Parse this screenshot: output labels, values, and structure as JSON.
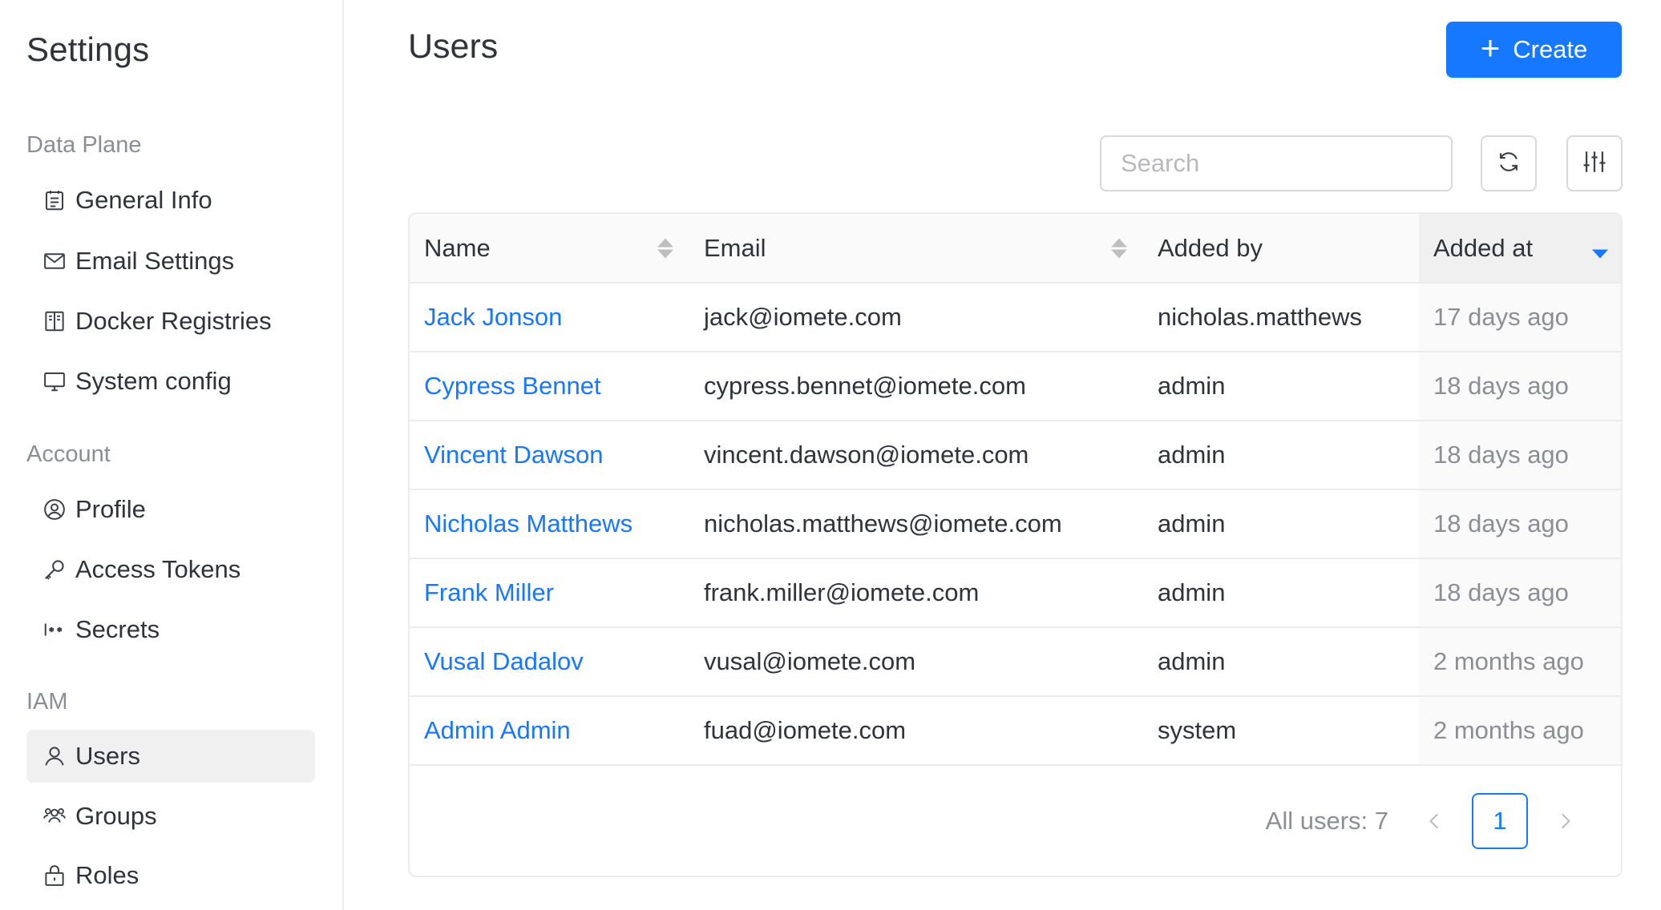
{
  "sidebar": {
    "title": "Settings",
    "sections": [
      {
        "label": "Data Plane",
        "items": [
          {
            "label": "General Info",
            "icon": "calendar-icon"
          },
          {
            "label": "Email Settings",
            "icon": "mail-icon"
          },
          {
            "label": "Docker Registries",
            "icon": "book-icon"
          },
          {
            "label": "System config",
            "icon": "desktop-icon"
          }
        ]
      },
      {
        "label": "Account",
        "items": [
          {
            "label": "Profile",
            "icon": "user-circle-icon"
          },
          {
            "label": "Access Tokens",
            "icon": "key-icon"
          },
          {
            "label": "Secrets",
            "icon": "secret-icon"
          }
        ]
      },
      {
        "label": "IAM",
        "items": [
          {
            "label": "Users",
            "icon": "user-icon",
            "active": true
          },
          {
            "label": "Groups",
            "icon": "team-icon"
          },
          {
            "label": "Roles",
            "icon": "lock-icon"
          }
        ]
      }
    ]
  },
  "main": {
    "title": "Users",
    "create_label": "Create",
    "search_placeholder": "Search",
    "table": {
      "columns": [
        "Name",
        "Email",
        "Added by",
        "Added at"
      ],
      "sorted_column": "Added at",
      "sort_direction": "descending",
      "rows": [
        {
          "name": "Jack Jonson",
          "email": "jack@iomete.com",
          "added_by": "nicholas.matthews",
          "added_at": "17 days ago"
        },
        {
          "name": "Cypress Bennet",
          "email": "cypress.bennet@iomete.com",
          "added_by": "admin",
          "added_at": "18 days ago"
        },
        {
          "name": "Vincent Dawson",
          "email": "vincent.dawson@iomete.com",
          "added_by": "admin",
          "added_at": "18 days ago"
        },
        {
          "name": "Nicholas Matthews",
          "email": "nicholas.matthews@iomete.com",
          "added_by": "admin",
          "added_at": "18 days ago"
        },
        {
          "name": "Frank Miller",
          "email": "frank.miller@iomete.com",
          "added_by": "admin",
          "added_at": "18 days ago"
        },
        {
          "name": "Vusal Dadalov",
          "email": "vusal@iomete.com",
          "added_by": "admin",
          "added_at": "2 months ago"
        },
        {
          "name": "Admin Admin",
          "email": "fuad@iomete.com",
          "added_by": "system",
          "added_at": "2 months ago"
        }
      ]
    },
    "pagination": {
      "total_label": "All users: 7",
      "current_page": "1"
    }
  },
  "colors": {
    "accent": "#1677ff",
    "active_nav_bg": "#f0f0f0",
    "muted_text": "#8b8f95"
  }
}
